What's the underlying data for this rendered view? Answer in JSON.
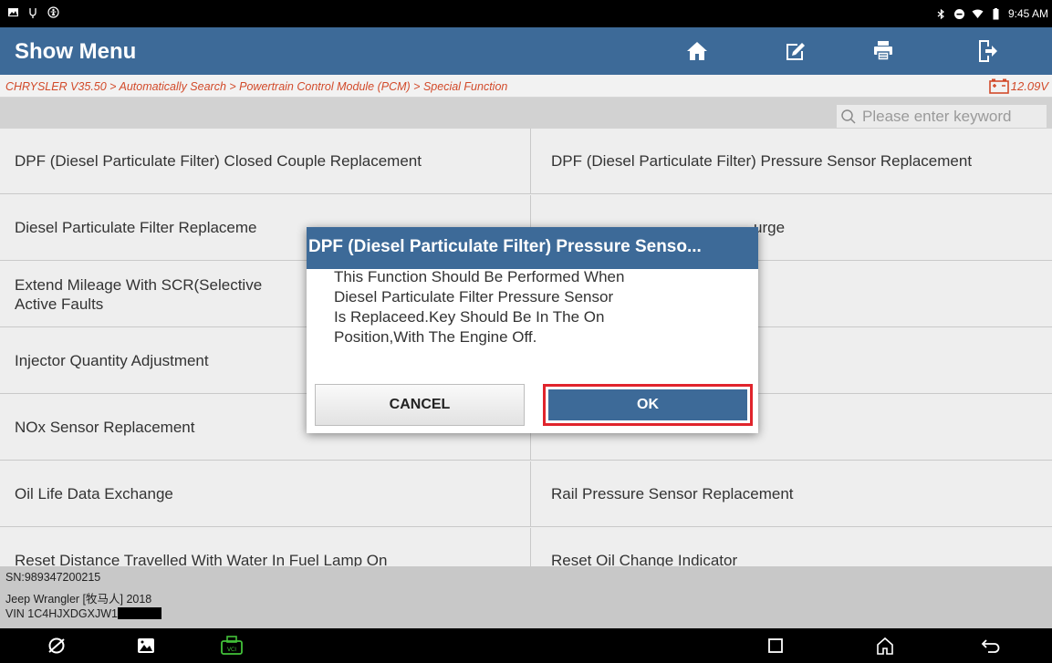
{
  "status_bar": {
    "time": "9:45 AM"
  },
  "header": {
    "title": "Show Menu",
    "icons": [
      "home-icon",
      "edit-icon",
      "print-icon",
      "exit-icon"
    ]
  },
  "breadcrumb": {
    "path": "CHRYSLER V35.50 > Automatically Search > Powertrain Control Module (PCM) > Special Function",
    "voltage": "12.09V"
  },
  "search": {
    "placeholder": "Please enter keyword"
  },
  "menu": {
    "rows": [
      [
        "DPF (Diesel Particulate Filter) Closed Couple Replacement",
        "DPF (Diesel Particulate Filter) Pressure Sensor Replacement"
      ],
      [
        "Diesel Particulate Filter Replaceme",
        "urge"
      ],
      [
        "Extend Mileage With SCR(Selective\nActive Faults",
        ""
      ],
      [
        "Injector Quantity Adjustment",
        ""
      ],
      [
        "NOx Sensor Replacement",
        ""
      ],
      [
        "Oil Life Data Exchange",
        "Rail Pressure Sensor Replacement"
      ],
      [
        "Reset Distance Travelled With Water In Fuel Lamp On",
        "Reset Oil Change Indicator"
      ]
    ]
  },
  "footer": {
    "sn": "SN:989347200215",
    "vehicle": "Jeep Wrangler [牧马人] 2018",
    "vin": "VIN 1C4HJXDGXJW1"
  },
  "dialog": {
    "title": "DPF (Diesel Particulate Filter) Pressure Senso...",
    "lines": [
      "This Function Should Be Performed When",
      "Diesel Particulate Filter Pressure Sensor",
      "Is Replaceed.Key Should Be In The On",
      "Position,With The Engine Off."
    ],
    "cancel_label": "CANCEL",
    "ok_label": "OK"
  },
  "colors": {
    "header": "#3d6a98",
    "breadcrumb_text": "#d24a2a",
    "highlight": "#e0242c"
  }
}
